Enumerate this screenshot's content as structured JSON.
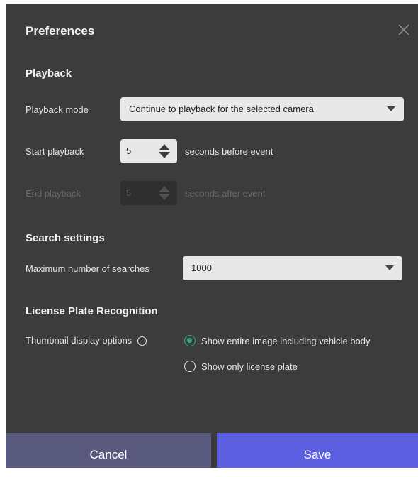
{
  "dialog": {
    "title": "Preferences"
  },
  "playback": {
    "section_title": "Playback",
    "mode_label": "Playback mode",
    "mode_value": "Continue to playback for the selected camera",
    "start_label": "Start playback",
    "start_value": "5",
    "start_suffix": "seconds before event",
    "end_label": "End playback",
    "end_value": "5",
    "end_suffix": "seconds after event"
  },
  "search": {
    "section_title": "Search settings",
    "max_label": "Maximum number of searches",
    "max_value": "1000"
  },
  "lpr": {
    "section_title": "License Plate Recognition",
    "thumb_label": "Thumbnail display options",
    "info_glyph": "i",
    "options": [
      {
        "label": "Show entire image including vehicle body",
        "checked": true
      },
      {
        "label": "Show only license plate",
        "checked": false
      }
    ]
  },
  "footer": {
    "cancel_label": "Cancel",
    "save_label": "Save"
  },
  "colors": {
    "dialog_bg": "#3c3c3c",
    "accent_radio": "#2ea88a",
    "save_bg": "#5b5fe0",
    "cancel_bg": "#5a5a7e"
  },
  "icons": [
    "close-icon",
    "chevron-down-icon",
    "spin-up-icon",
    "spin-down-icon",
    "info-icon"
  ]
}
